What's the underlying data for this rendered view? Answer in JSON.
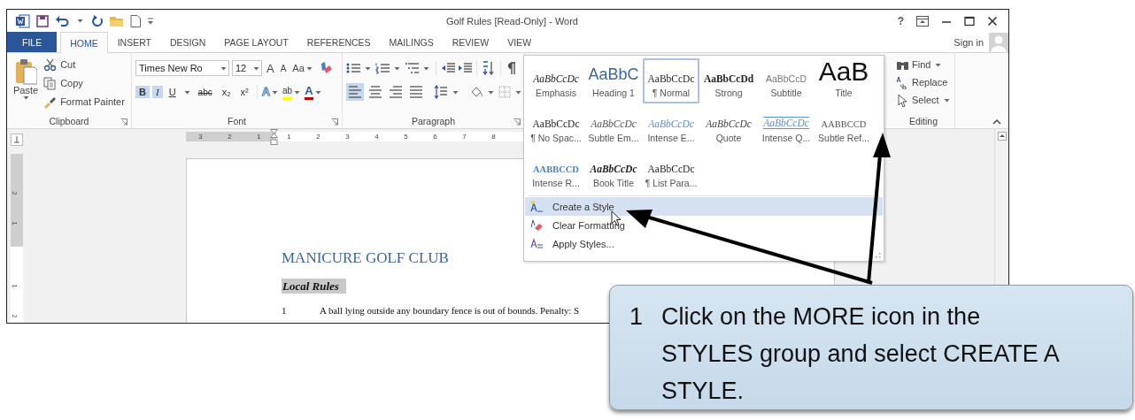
{
  "window": {
    "title": "Golf Rules [Read-Only] - Word",
    "help": "?"
  },
  "tabs": [
    {
      "label": "FILE",
      "kind": "file",
      "selected": false
    },
    {
      "label": "HOME",
      "kind": "tab",
      "selected": true
    },
    {
      "label": "INSERT",
      "kind": "tab",
      "selected": false
    },
    {
      "label": "DESIGN",
      "kind": "tab",
      "selected": false
    },
    {
      "label": "PAGE LAYOUT",
      "kind": "tab",
      "selected": false
    },
    {
      "label": "REFERENCES",
      "kind": "tab",
      "selected": false
    },
    {
      "label": "MAILINGS",
      "kind": "tab",
      "selected": false
    },
    {
      "label": "REVIEW",
      "kind": "tab",
      "selected": false
    },
    {
      "label": "VIEW",
      "kind": "tab",
      "selected": false
    }
  ],
  "account": {
    "label": "Sign in"
  },
  "ribbon": {
    "clipboard": {
      "label": "Clipboard",
      "paste": "Paste",
      "commands": [
        "Cut",
        "Copy",
        "Format Painter"
      ]
    },
    "font": {
      "label": "Font",
      "name": "Times New Ro",
      "size": "12",
      "size_buttons": [
        "A",
        "A"
      ],
      "case": "Aa",
      "format": [
        {
          "label": "B",
          "selected": true
        },
        {
          "label": "I",
          "selected": true
        },
        {
          "label": "U",
          "selected": false
        },
        {
          "label": "abc",
          "selected": false
        },
        {
          "label": "x₂",
          "selected": false
        },
        {
          "label": "x²",
          "selected": false
        }
      ],
      "effects": [
        {
          "kind": "text_effects",
          "label": "A"
        },
        {
          "kind": "highlight",
          "label": "ab"
        },
        {
          "kind": "font_color",
          "label": "A"
        }
      ]
    },
    "paragraph": {
      "label": "Paragraph",
      "alignment": [
        {
          "selected": true
        },
        {
          "selected": false
        },
        {
          "selected": false
        },
        {
          "selected": false
        }
      ]
    },
    "editing": {
      "label": "Editing",
      "commands": [
        {
          "label": "Find",
          "kind": "menu"
        },
        {
          "label": "Replace",
          "kind": "plain"
        },
        {
          "label": "Select",
          "kind": "menu"
        }
      ]
    }
  },
  "ruler": {
    "horizontal": [
      "3",
      "2",
      "1",
      "1",
      "2",
      "3",
      "4",
      "5",
      "6",
      "7",
      "8"
    ],
    "vertical": [
      "2",
      "1",
      "1",
      "2"
    ]
  },
  "document": {
    "heading": "MANICURE GOLF CLUB",
    "subheading": "Local Rules",
    "rules": [
      {
        "number": "1",
        "text": "A ball lying outside any boundary fence is out of bounds.  Penalty: S"
      }
    ]
  },
  "styles_gallery": {
    "styles": [
      {
        "preview": "AaBbCcDc",
        "name": "Emphasis",
        "kind": "emphasis",
        "selected": false
      },
      {
        "preview": "AaBbC",
        "name": "Heading 1",
        "kind": "heading1",
        "selected": false
      },
      {
        "preview": "AaBbCcDc",
        "name": "¶ Normal",
        "kind": "normal",
        "selected": true
      },
      {
        "preview": "AaBbCcDd",
        "name": "Strong",
        "kind": "strong",
        "selected": false
      },
      {
        "preview": "AaBbCcD",
        "name": "Subtitle",
        "kind": "subtitle",
        "selected": false
      },
      {
        "preview": "AaB",
        "name": "Title",
        "kind": "title",
        "selected": false
      },
      {
        "preview": "AaBbCcDc",
        "name": "¶ No Spac...",
        "kind": "no_spacing",
        "selected": false
      },
      {
        "preview": "AaBbCcDc",
        "name": "Subtle Em...",
        "kind": "subtle_emphasis",
        "selected": false
      },
      {
        "preview": "AaBbCcDc",
        "name": "Intense E...",
        "kind": "intense_emphasis",
        "selected": false
      },
      {
        "preview": "AaBbCcDc",
        "name": "Quote",
        "kind": "quote",
        "selected": false
      },
      {
        "preview": "AaBbCcDc",
        "name": "Intense Q...",
        "kind": "intense_quote",
        "selected": false
      },
      {
        "preview": "AABBCCD",
        "name": "Subtle Ref...",
        "kind": "subtle_reference",
        "selected": false
      },
      {
        "preview": "AABBCCD",
        "name": "Intense R...",
        "kind": "intense_reference",
        "selected": false
      },
      {
        "preview": "AaBbCcDc",
        "name": "Book Title",
        "kind": "book_title",
        "selected": false
      },
      {
        "preview": "AaBbCcDc",
        "name": "¶ List Para...",
        "kind": "list_paragraph",
        "selected": false
      }
    ],
    "menu": [
      {
        "label": "Create a Style",
        "selected": true
      },
      {
        "label": "Clear Formatting",
        "selected": false
      },
      {
        "label": "Apply Styles...",
        "selected": false
      }
    ]
  },
  "callout": {
    "number": "1",
    "text": "Click on the MORE icon in the STYLES group and select CREATE A STYLE."
  }
}
